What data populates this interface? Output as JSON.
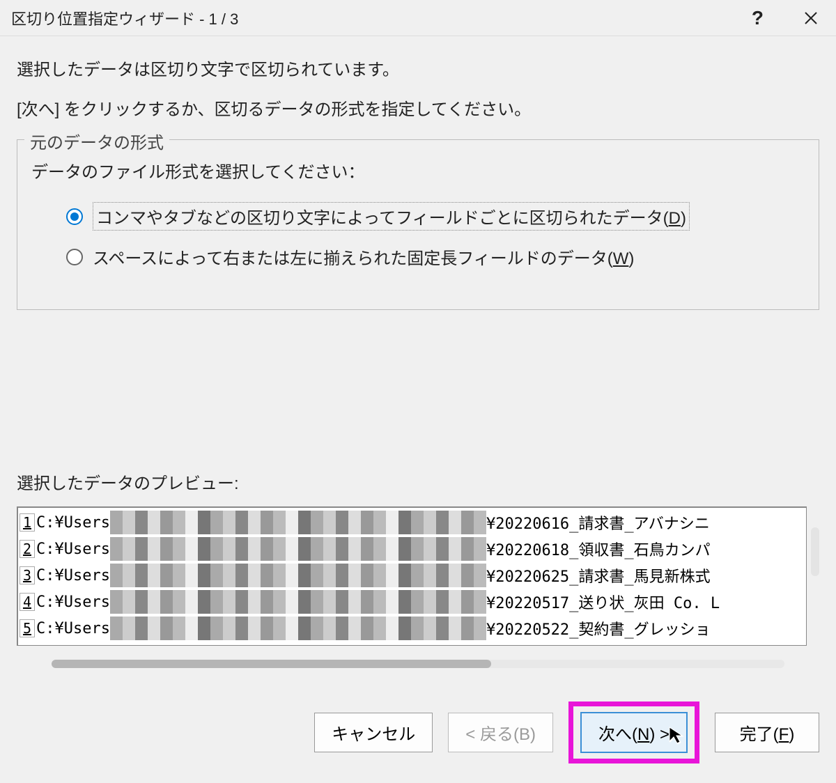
{
  "titlebar": {
    "title": "区切り位置指定ウィザード - 1 / 3"
  },
  "intro": {
    "line1": "選択したデータは区切り文字で区切られています。",
    "line2": "[次へ] をクリックするか、区切るデータの形式を指定してください。"
  },
  "groupbox": {
    "legend": "元のデータの形式",
    "prompt": "データのファイル形式を選択してください：",
    "option1_text": "コンマやタブなどの区切り文字によってフィールドごとに区切られたデータ(",
    "option1_accel": "D",
    "option1_close": ")",
    "option2_text": "スペースによって右または左に揃えられた固定長フィールドのデータ(",
    "option2_accel": "W",
    "option2_close": ")"
  },
  "preview": {
    "label": "選択したデータのプレビュー:",
    "rows": [
      {
        "n": "1",
        "left": "C:¥Users",
        "right": "¥20220616_請求書_アバナシニ"
      },
      {
        "n": "2",
        "left": "C:¥Users",
        "right": "¥20220618_領収書_石鳥カンパ"
      },
      {
        "n": "3",
        "left": "C:¥Users",
        "right": "¥20220625_請求書_馬見新株式"
      },
      {
        "n": "4",
        "left": "C:¥Users",
        "right": "¥20220517_送り状_灰田 Co. L"
      },
      {
        "n": "5",
        "left": "C:¥Users",
        "right": "¥20220522_契約書_グレッショ"
      }
    ]
  },
  "buttons": {
    "cancel": "キャンセル",
    "back": "< 戻る(B)",
    "next_pre": "次へ(",
    "next_accel": "N",
    "next_post": ") >",
    "finish_pre": "完了(",
    "finish_accel": "F",
    "finish_post": ")"
  }
}
